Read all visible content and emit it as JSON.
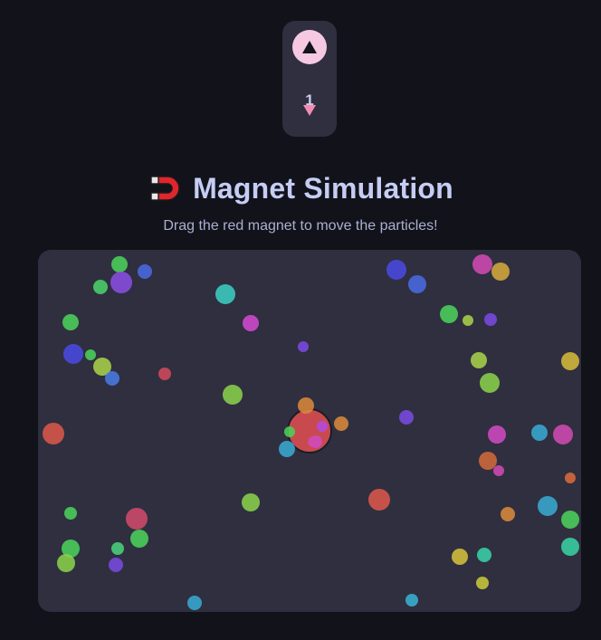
{
  "counter": {
    "value": "1",
    "up_symbol": "▲",
    "down_symbol": "▼"
  },
  "header": {
    "icon": "magnet-icon",
    "title": "Magnet Simulation"
  },
  "instructions": "Drag the red magnet to move the particles!",
  "colors": {
    "page_bg": "#12121a",
    "panel_bg": "#2f2f40",
    "title": "#c6cdf4",
    "subtitle": "#aab0d0",
    "up_button": "#f6c9e3",
    "down_arrow": "#f28cb0",
    "magnet": "#c84a4f"
  },
  "particles": [
    {
      "c": "#4bd05a"
    },
    {
      "c": "#8a4fe0"
    },
    {
      "c": "#4a6ae0"
    },
    {
      "c": "#4bd06a"
    },
    {
      "c": "#3ccdc0"
    },
    {
      "c": "#4bd05a"
    },
    {
      "c": "#d24ad0"
    },
    {
      "c": "#4a4ae0"
    },
    {
      "c": "#4bd05a"
    },
    {
      "c": "#a8d04a"
    },
    {
      "c": "#4a7ae0"
    },
    {
      "c": "#d04a5a"
    },
    {
      "c": "#7a4ae0"
    },
    {
      "c": "#8ad04a"
    },
    {
      "c": "#d9584a"
    },
    {
      "c": "#4a4ae0"
    },
    {
      "c": "#4a6ae0"
    },
    {
      "c": "#d04ab0"
    },
    {
      "c": "#d4a83a"
    },
    {
      "c": "#4bd05a"
    },
    {
      "c": "#a8d04a"
    },
    {
      "c": "#7a4ae0"
    },
    {
      "c": "#a8d04a"
    },
    {
      "c": "#8ad04a"
    },
    {
      "c": "#d4b83a"
    },
    {
      "c": "#d8873a"
    },
    {
      "c": "#d88a3a"
    },
    {
      "c": "#7a4ae0"
    },
    {
      "c": "#3aa8d0"
    },
    {
      "c": "#4bd05a"
    },
    {
      "c": "#d04ac0"
    },
    {
      "c": "#b04ae0"
    },
    {
      "c": "#3aa8d0"
    },
    {
      "c": "#d04ac0"
    },
    {
      "c": "#d04ab0"
    },
    {
      "c": "#d06a3a"
    },
    {
      "c": "#d04ab0"
    },
    {
      "c": "#d86a3a"
    },
    {
      "c": "#d9584a"
    },
    {
      "c": "#8ad04a"
    },
    {
      "c": "#4bd05a"
    },
    {
      "c": "#d04a6a"
    },
    {
      "c": "#4bd05a"
    },
    {
      "c": "#4bd05a"
    },
    {
      "c": "#8ad04a"
    },
    {
      "c": "#4bd07a"
    },
    {
      "c": "#7a4ae0"
    },
    {
      "c": "#3aa8d0"
    },
    {
      "c": "#4bd05a"
    },
    {
      "c": "#d04ab0"
    },
    {
      "c": "#d88a3a"
    },
    {
      "c": "#3ad0a8"
    },
    {
      "c": "#3ad0a0"
    },
    {
      "c": "#d4c03a"
    },
    {
      "c": "#c8c83a"
    },
    {
      "c": "#3aa8d0"
    },
    {
      "c": "#3ab0d0"
    }
  ]
}
